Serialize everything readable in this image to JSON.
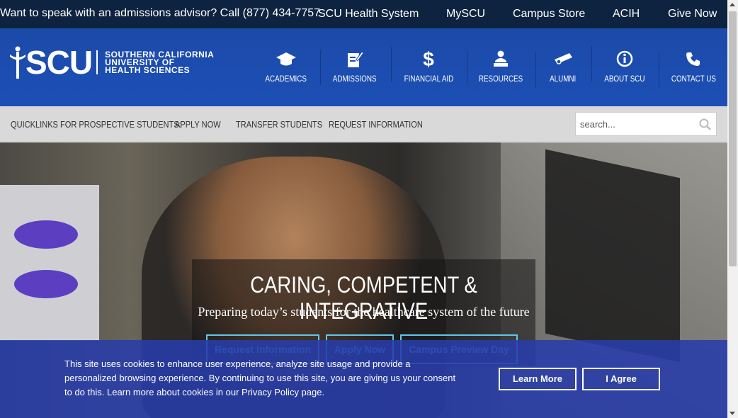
{
  "topbar": {
    "phone_text": "Want to speak with an admissions advisor? Call (877) 434-7757",
    "links": [
      "SCU Health System",
      "MySCU",
      "Campus Store",
      "ACIH",
      "Give Now"
    ]
  },
  "logo": {
    "mark": "SCU",
    "line1": "SOUTHERN CALIFORNIA",
    "line2": "UNIVERSITY OF",
    "line3": "HEALTH SCIENCES"
  },
  "nav": [
    {
      "label": "ACADEMICS",
      "icon": "graduation-cap-icon"
    },
    {
      "label": "ADMISSIONS",
      "icon": "edit-document-icon"
    },
    {
      "label": "FINANCIAL AID",
      "icon": "dollar-icon"
    },
    {
      "label": "RESOURCES",
      "icon": "people-icon"
    },
    {
      "label": "ALUMNI",
      "icon": "diploma-icon"
    },
    {
      "label": "ABOUT SCU",
      "icon": "info-icon"
    },
    {
      "label": "CONTACT US",
      "icon": "phone-icon"
    }
  ],
  "quicklinks": {
    "heading": "QUICKLINKS FOR PROSPECTIVE STUDENTS:",
    "links": [
      "APPLY NOW",
      "TRANSFER STUDENTS",
      "REQUEST INFORMATION"
    ]
  },
  "search": {
    "placeholder": "search..."
  },
  "hero": {
    "title": "CARING, COMPETENT & INTEGRATIVE",
    "subtitle": "Preparing today’s students for the healthcare system of the future",
    "buttons": [
      "Request Information",
      "Apply Now",
      "Campus Preview Day"
    ]
  },
  "cookie": {
    "text": "This site uses cookies to enhance user experience, analyze site usage and provide a personalized browsing experience. By continuing to use this site, you are giving us your consent to do this. Learn more about cookies in our Privacy Policy page.",
    "learn_more": "Learn More",
    "agree": "I Agree"
  },
  "colors": {
    "topbar_bg": "#0d2340",
    "header_bg": "#1d4fb5",
    "quick_bg": "#d9d9d9",
    "cookie_bg": "#283caa",
    "hero_button": "#5fc7e8"
  }
}
